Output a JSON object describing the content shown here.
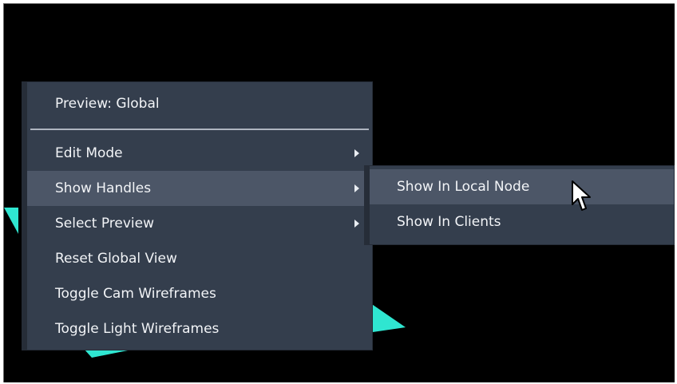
{
  "context_menu": {
    "items": [
      {
        "label": "Preview: Global"
      },
      {
        "label": "Edit Mode"
      },
      {
        "label": "Show Handles"
      },
      {
        "label": "Select Preview"
      },
      {
        "label": "Reset Global View"
      },
      {
        "label": "Toggle Cam Wireframes"
      },
      {
        "label": "Toggle Light Wireframes"
      }
    ]
  },
  "submenu": {
    "items": [
      {
        "label": "Show In Local Node"
      },
      {
        "label": "Show In Clients"
      }
    ]
  },
  "colors": {
    "menu_bg": "#343e4d",
    "menu_highlight": "#4c5667",
    "menu_edge": "#262d38",
    "viewport_bg": "#000000",
    "geometry_accent": "#2fe6d1"
  },
  "icons": {
    "submenu_arrow": "chevron-right-icon",
    "pointer": "cursor-icon"
  }
}
